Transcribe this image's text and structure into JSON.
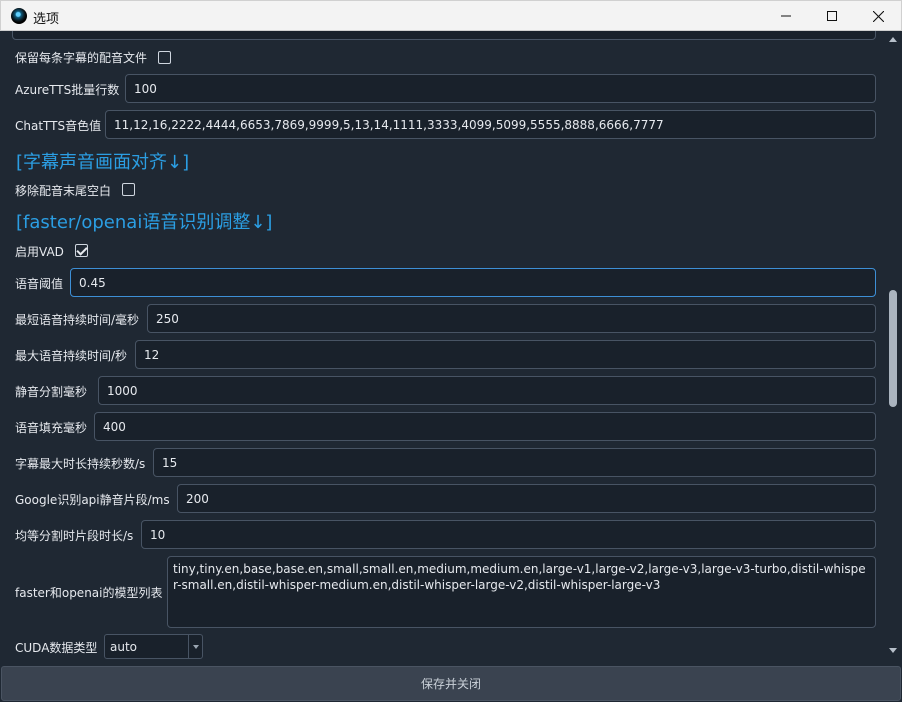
{
  "window": {
    "title": "选项"
  },
  "fields": {
    "keep_audio_label": "保留每条字幕的配音文件",
    "azure_label": "AzureTTS批量行数",
    "azure_value": "100",
    "chattts_label": "ChatTTS音色值",
    "chattts_value": "11,12,16,2222,4444,6653,7869,9999,5,13,14,1111,3333,4099,5099,5555,8888,6666,7777",
    "section_align": "[字幕声音画面对齐↓]",
    "remove_silence_label": "移除配音末尾空白",
    "section_asr": "[faster/openai语音识别调整↓]",
    "vad_label": "启用VAD",
    "threshold_label": "语音阈值",
    "threshold_value": "0.45",
    "min_speech_label": "最短语音持续时间/毫秒",
    "min_speech_value": "250",
    "max_speech_label": "最大语音持续时间/秒",
    "max_speech_value": "12",
    "silence_split_label": "静音分割毫秒",
    "silence_split_value": "1000",
    "speech_pad_label": "语音填充毫秒",
    "speech_pad_value": "400",
    "max_sub_label": "字幕最大时长持续秒数/s",
    "max_sub_value": "15",
    "google_label": "Google识别api静音片段/ms",
    "google_value": "200",
    "equal_split_label": "均等分割时片段时长/s",
    "equal_split_value": "10",
    "models_label": "faster和openai的模型列表",
    "models_value": "tiny,tiny.en,base,base.en,small,small.en,medium,medium.en,large-v1,large-v2,large-v3,large-v3-turbo,distil-whisper-small.en,distil-whisper-medium.en,distil-whisper-large-v2,distil-whisper-large-v3",
    "cuda_label": "CUDA数据类型",
    "cuda_value": "auto"
  },
  "states": {
    "keep_audio_checked": false,
    "remove_silence_checked": false,
    "vad_checked": true
  },
  "footer": {
    "save_label": "保存并关闭"
  },
  "colors": {
    "accent": "#2b9ee3",
    "background": "#1f2833",
    "field_bg": "#19212b",
    "focus_border": "#3d8fd6"
  },
  "icons": [
    "app-icon",
    "minimize-icon",
    "maximize-icon",
    "close-icon",
    "checkbox-icon",
    "chevron-down-icon"
  ]
}
